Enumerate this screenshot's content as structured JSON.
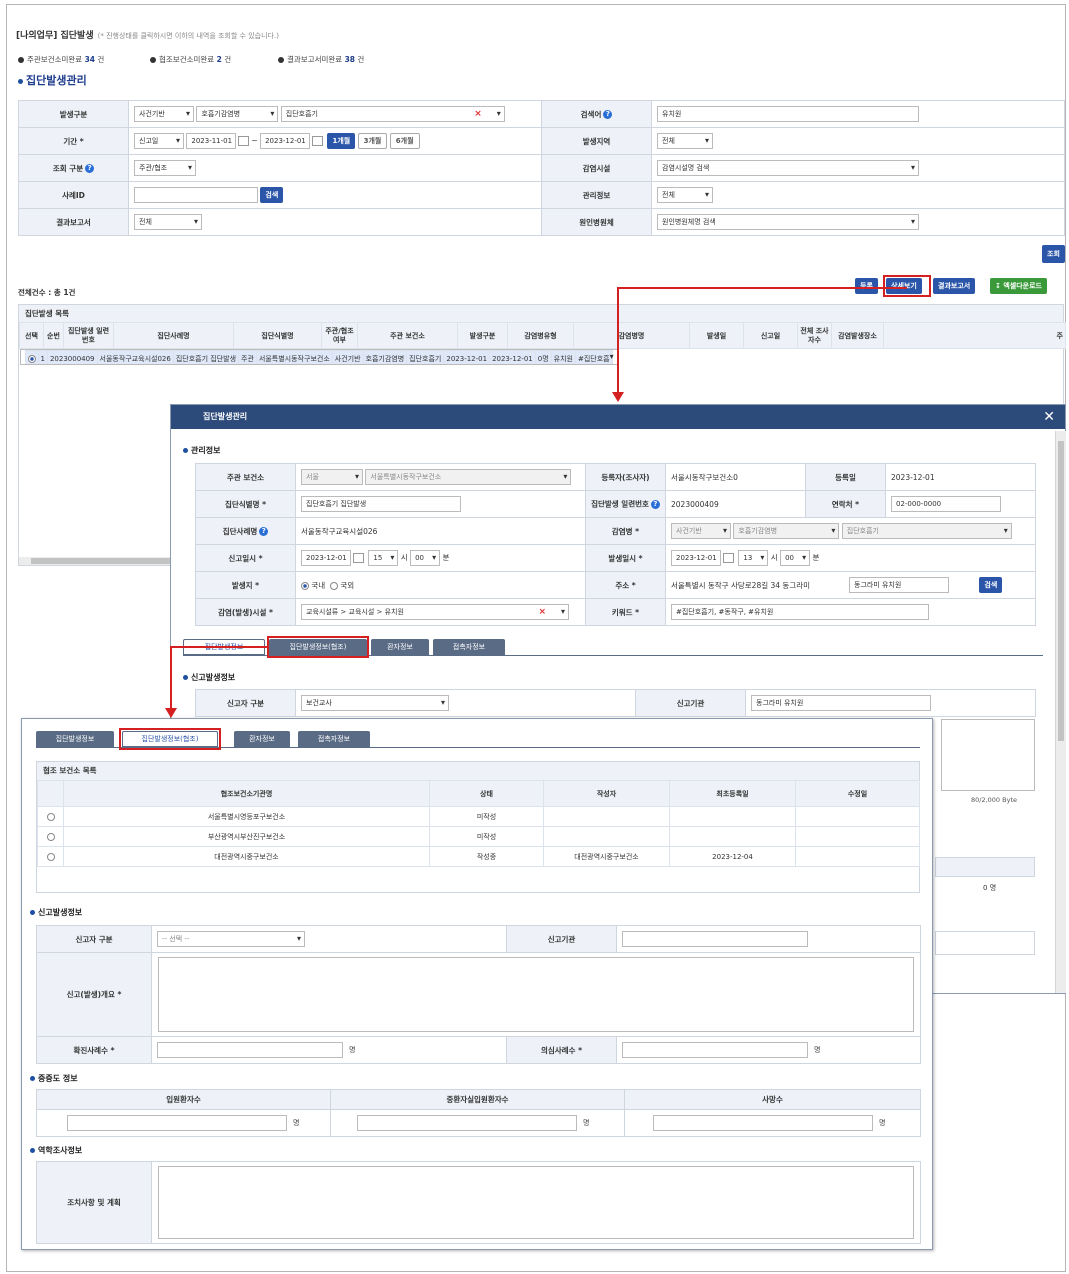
{
  "header": {
    "breadcrumb": "[나의업무] 집단발생",
    "hint": "(* 진행상태를 클릭하시면 이하의 내역을 조회할 수 있습니다.)",
    "stats": [
      {
        "label": "주관보건소미완료",
        "count": "34",
        "unit": "건"
      },
      {
        "label": "협조보건소미완료",
        "count": "2",
        "unit": "건"
      },
      {
        "label": "결과보고서미완료",
        "count": "38",
        "unit": "건"
      }
    ],
    "page_title": "집단발생관리"
  },
  "search": {
    "occurrence_type_label": "발생구분",
    "occurrence_type_values": [
      "사건기반",
      "호흡기감염병",
      "집단호흡기"
    ],
    "period_label": "기간 *",
    "period_basis": "신고일",
    "period_from": "2023-11-01",
    "period_tilde": "~",
    "period_to": "2023-12-01",
    "period_buttons": [
      "1개월",
      "3개월",
      "6개월"
    ],
    "query_type_label": "조회 구분",
    "query_type_value": "주관/협조",
    "case_id_label": "사례ID",
    "search_button": "검색",
    "result_report_label": "결과보고서",
    "result_report_value": "전체",
    "keyword_label": "검색어",
    "keyword_value": "유치원",
    "region_label": "발생지역",
    "region_value": "전체",
    "facility_label": "감염시설",
    "facility_value": "감염시설명 검색",
    "admin_info_label": "관리정보",
    "admin_info_value": "전체",
    "pathogen_label": "원인병원체",
    "pathogen_value": "원인병원체명 검색",
    "query_button": "조회"
  },
  "results": {
    "total": "전체건수 : 총 1건",
    "list_title": "집단발생 목록",
    "buttons": [
      "등록",
      "상세보기",
      "결과보고서",
      "엑셀다운로드"
    ],
    "columns": [
      "선택",
      "순번",
      "집단발생 일련번호",
      "집단사례명",
      "집단식별명",
      "주관/협조 여부",
      "주관 보건소",
      "발생구분",
      "감염병유형",
      "감염병명",
      "발생일",
      "신고일",
      "전체 조사자수",
      "감염발생장소",
      "주"
    ],
    "row": [
      "",
      "1",
      "2023000409",
      "서울동작구교육시설026",
      "집단호흡기 집단발생",
      "주관",
      "서울특별시동작구보건소",
      "사건기반",
      "호흡기감염병",
      "집단호흡기",
      "2023-12-01",
      "2023-12-01",
      "0명",
      "유치원",
      "#집단호흡"
    ]
  },
  "modal": {
    "title": "집단발생관리",
    "section_admin": "관리정보",
    "lead_hc_label": "주관 보건소",
    "lead_hc_city": "서울",
    "lead_hc_name": "서울특별시동작구보건소",
    "registrant_label": "등록자(조사자)",
    "registrant_value": "서울시동작구보건소0",
    "reg_date_label": "등록일",
    "reg_date_value": "2023-12-01",
    "group_id_label": "집단식별명 *",
    "group_id_value": "집단호흡기 집단발생",
    "serial_label": "집단발생 일련번호",
    "serial_value": "2023000409",
    "contact_label": "연락처 *",
    "contact_value": "02-000-0000",
    "case_name_label": "집단사례명",
    "case_name_value": "서울동작구교육시설026",
    "disease_label": "감염병 *",
    "disease_values": [
      "사건기반",
      "호흡기감염병",
      "집단호흡기"
    ],
    "report_dt_label": "신고일시 *",
    "report_date": "2023-12-01",
    "report_hour": "15",
    "report_min": "00",
    "hour_unit": "시",
    "min_unit": "분",
    "occ_dt_label": "발생일시 *",
    "occ_date": "2023-12-01",
    "occ_hour": "13",
    "occ_min": "00",
    "place_label": "발생지 *",
    "place_domestic": "국내",
    "place_foreign": "국외",
    "address_label": "주소 *",
    "address_value": "서울특별시 동작구 사당로28길 34 동그라미",
    "address_detail": "동그라미 유치원",
    "address_search": "검색",
    "facility_label": "감염(발생)시설 *",
    "facility_value": "교육시설류 > 교육시설 > 유치원",
    "keyword_label": "키워드 *",
    "keyword_value": "#집단호흡기, #동작구, #유치원",
    "tabs": [
      "집단발생정보",
      "집단발생정보(협조)",
      "환자정보",
      "접촉자정보"
    ],
    "section_report": "신고발생정보",
    "reporter_type_label": "신고자 구분",
    "reporter_type_value": "보건교사",
    "report_org_label": "신고기관",
    "report_org_value": "동그라미 유치원",
    "byte_counter": "80/2,000 Byte",
    "count_unit": "명",
    "zero_count": "0"
  },
  "zoom": {
    "tabs": [
      "집단발생정보",
      "집단발생정보(협조)",
      "환자정보",
      "접촉자정보"
    ],
    "coop_list_title": "협조 보건소 목록",
    "coop_columns": [
      "",
      "협조보건소기관명",
      "상태",
      "작성자",
      "최초등록일",
      "수정일"
    ],
    "coop_rows": [
      [
        "",
        "서울특별시영등포구보건소",
        "미작성",
        "",
        "",
        ""
      ],
      [
        "",
        "부산광역시부산진구보건소",
        "미작성",
        "",
        "",
        ""
      ],
      [
        "",
        "대전광역시중구보건소",
        "작성중",
        "대전광역시중구보건소",
        "2023-12-04",
        ""
      ]
    ],
    "section_report": "신고발생정보",
    "reporter_type_label": "신고자 구분",
    "reporter_type_placeholder": "-- 선택 --",
    "report_org_label": "신고기관",
    "summary_label": "신고(발생)개요 *",
    "confirmed_label": "확진사례수 *",
    "suspected_label": "의심사례수 *",
    "unit": "명",
    "section_severity": "중증도 정보",
    "severity_columns": [
      "입원환자수",
      "중환자실입원환자수",
      "사망수"
    ],
    "section_epi": "역학조사정보",
    "action_label": "조치사항 및 계획"
  }
}
